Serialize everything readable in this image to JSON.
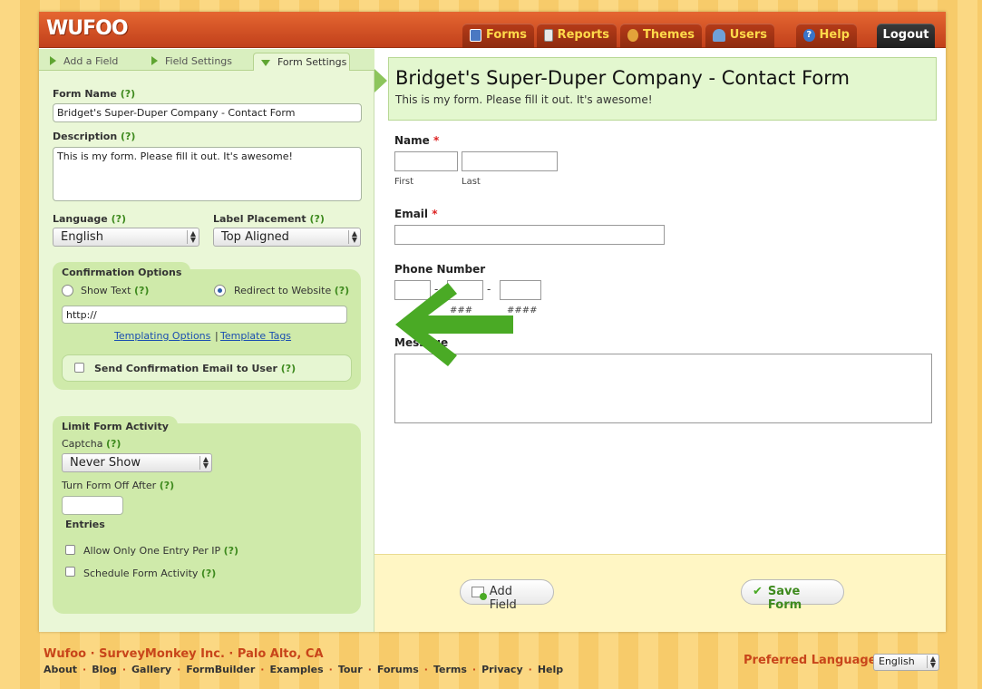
{
  "header": {
    "logo": "WUFOO",
    "nav": [
      {
        "label": "Forms",
        "icon": "forms-icon",
        "color": "#4a78c2"
      },
      {
        "label": "Reports",
        "icon": "reports-icon",
        "color": "#d9d9d9"
      },
      {
        "label": "Themes",
        "icon": "themes-icon",
        "color": "#e3a33a"
      },
      {
        "label": "Users",
        "icon": "users-icon",
        "color": "#6fa0d8"
      },
      {
        "label": "Help",
        "icon": "help-icon",
        "color": "#3a74c8"
      },
      {
        "label": "Logout"
      }
    ]
  },
  "tabs": {
    "add_field": "Add a Field",
    "field_settings": "Field Settings",
    "form_settings": "Form Settings"
  },
  "settings": {
    "form_name_label": "Form Name",
    "help": "(?)",
    "form_name_value": "Bridget's Super-Duper Company - Contact Form",
    "description_label": "Description",
    "description_value": "This is my form. Please fill it out. It's awesome!",
    "language_label": "Language",
    "language_value": "English",
    "label_placement_label": "Label Placement",
    "label_placement_value": "Top Aligned",
    "confirmation": {
      "title": "Confirmation Options",
      "show_text": "Show Text",
      "redirect": "Redirect to Website",
      "redirect_value": "http://",
      "templating_options": "Templating Options",
      "separator": "|",
      "template_tags": "Template Tags",
      "send_email": "Send Confirmation Email to User"
    },
    "limit": {
      "title": "Limit Form Activity",
      "captcha_label": "Captcha",
      "captcha_value": "Never Show",
      "turn_off_label": "Turn Form Off After",
      "entries": "Entries",
      "one_entry": "Allow Only One Entry Per IP",
      "schedule": "Schedule Form Activity"
    }
  },
  "form": {
    "title": "Bridget's Super-Duper Company - Contact Form",
    "description": "This is my form. Please fill it out. It's awesome!",
    "name_label": "Name",
    "required": "*",
    "first": "First",
    "last": "Last",
    "email_label": "Email",
    "phone_label": "Phone Number",
    "dash": "-",
    "phone_hint_1": "###",
    "phone_hint_2": "####",
    "message_label": "Message",
    "add_field": "Add Field",
    "save_form": "Save Form"
  },
  "footer": {
    "brand": [
      "Wufoo",
      "SurveyMonkey Inc.",
      "Palo Alto, CA"
    ],
    "links": [
      "About",
      "Blog",
      "Gallery",
      "FormBuilder",
      "Examples",
      "Tour",
      "Forums",
      "Terms",
      "Privacy",
      "Help"
    ],
    "pref_lang_label": "Preferred Language :",
    "pref_lang_value": "English"
  },
  "colors": {
    "accent": "#c8451a",
    "green": "#4aaa25",
    "panel": "#eaf7d7"
  }
}
